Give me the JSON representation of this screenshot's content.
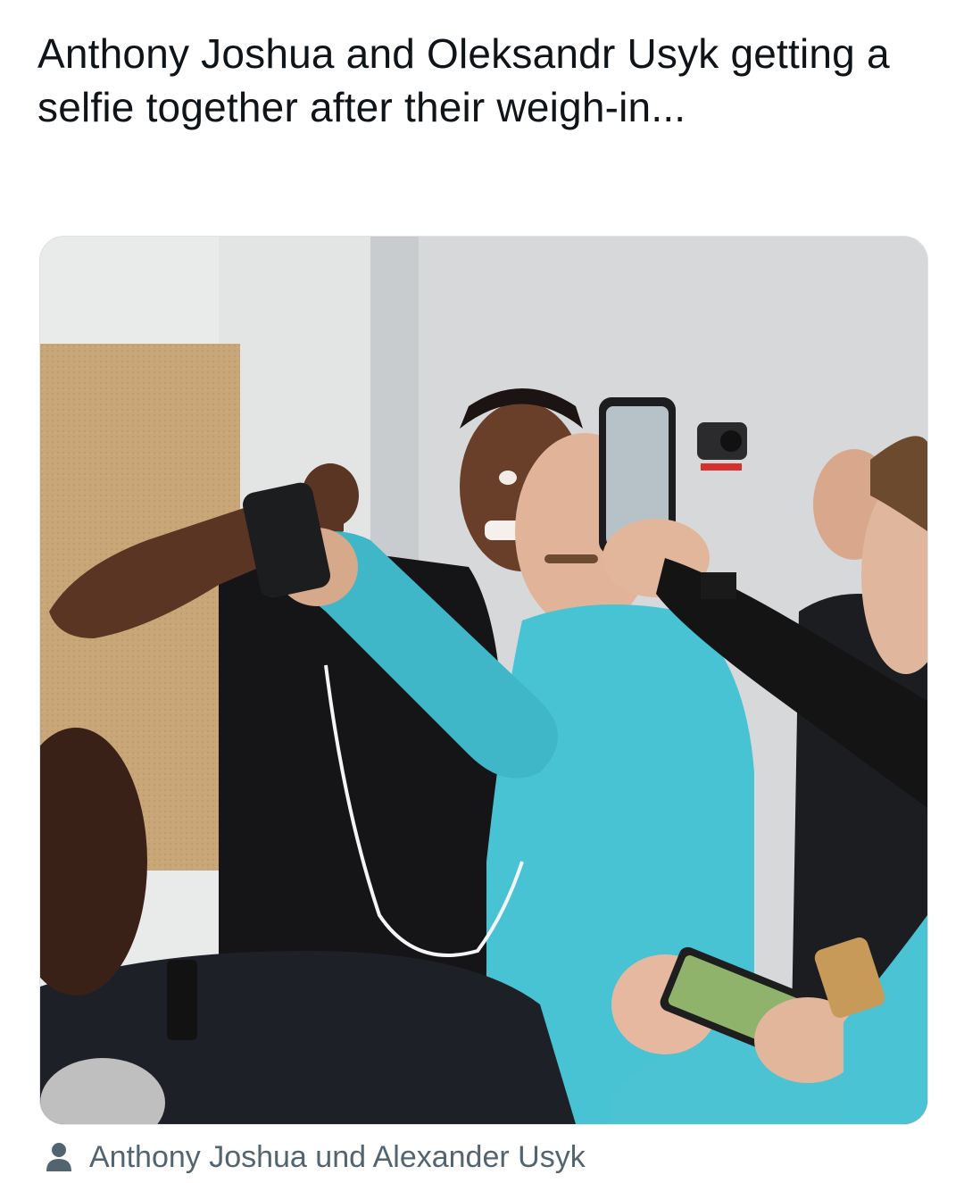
{
  "tweet": {
    "text": "Anthony Joshua and Oleksandr Usyk getting a selfie together after their weigh-in..."
  },
  "media": {
    "description_tagged": "Anthony Joshua und Alexander Usyk",
    "tag_icon": "person-icon"
  },
  "colors": {
    "text_primary": "#0f1419",
    "text_secondary": "#536471",
    "card_border": "#dfe3e6"
  }
}
